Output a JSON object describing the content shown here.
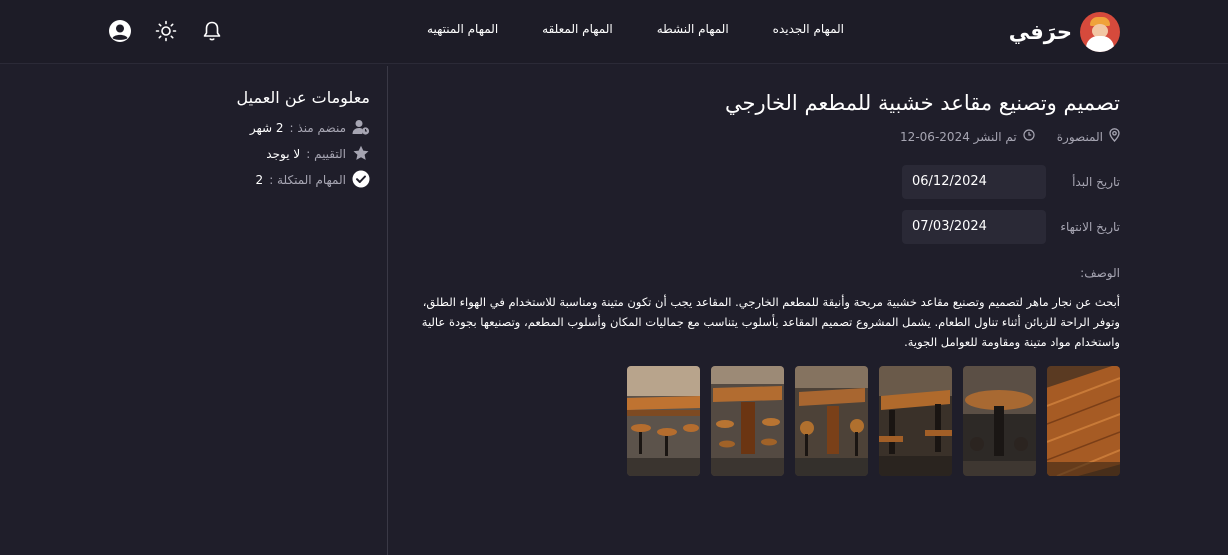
{
  "header": {
    "brand": "حرَفي",
    "nav": [
      "المهام الجديده",
      "المهام النشطه",
      "المهام المعلقه",
      "المهام المنتهيه"
    ]
  },
  "task": {
    "title": "تصميم وتصنيع مقاعد خشبية للمطعم الخارجي",
    "location": "المنصورة",
    "published": "تم النشر 2024-06-12",
    "start_label": "تاريخ البدأ",
    "start_value": "06/12/2024",
    "end_label": "تاريخ الانتهاء",
    "end_value": "07/03/2024",
    "description_label": "الوصف:",
    "description": "أبحث عن نجار ماهر لتصميم وتصنيع مقاعد خشبية مريحة وأنيقة للمطعم الخارجي. المقاعد يجب أن تكون متينة ومناسبة للاستخدام في الهواء الطلق، وتوفر الراحة للزبائن أثناء تناول الطعام. يشمل المشروع تصميم المقاعد بأسلوب يتناسب مع جماليات المكان وأسلوب المطعم، وتصنيعها بجودة عالية واستخدام مواد متينة ومقاومة للعوامل الجوية."
  },
  "client": {
    "title": "معلومات عن العميل",
    "joined_label": "منضم منذ :",
    "joined_value": "2 شهر",
    "rating_label": "التقييم :",
    "rating_value": "لا يوجد",
    "completed_label": "المهام المتكلة :",
    "completed_value": "2"
  },
  "colors": {
    "background": "#1f1e2a",
    "field": "#2a2936",
    "wood": "#b0642a"
  },
  "icons": [
    "bell-icon",
    "sun-icon",
    "user-circle-icon",
    "location-pin-icon",
    "clock-icon",
    "user-clock-icon",
    "star-icon",
    "check-circle-icon"
  ]
}
